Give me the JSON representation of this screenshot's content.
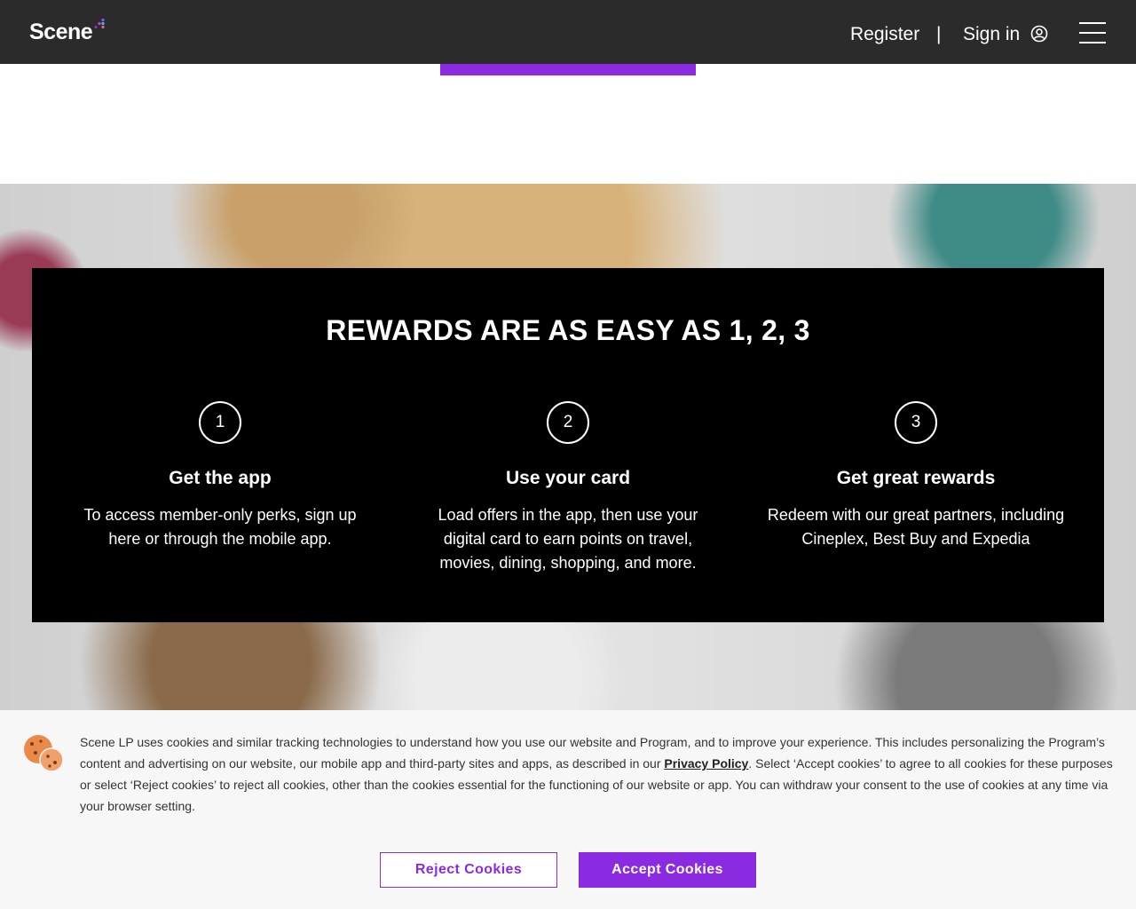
{
  "header": {
    "logo": "Scene",
    "register": "Register",
    "separator": "|",
    "signin": "Sign in"
  },
  "rewards": {
    "title": "REWARDS ARE AS EASY AS 1, 2, 3",
    "steps": [
      {
        "num": "1",
        "title": "Get the app",
        "text": "To access member-only perks, sign up here or through the mobile app."
      },
      {
        "num": "2",
        "title": "Use your card",
        "text": "Load offers in the app, then use your digital card to earn points on travel, movies, dining, shopping, and more."
      },
      {
        "num": "3",
        "title": "Get great rewards",
        "text": "Redeem with our great partners, including Cineplex, Best Buy and Expedia"
      }
    ]
  },
  "cookie": {
    "text_before": "Scene LP uses cookies and similar tracking technologies to understand how you use our website and Program, and to improve your experience. This includes personalizing the Program’s content and advertising on our website, our mobile app and third-party sites and apps, as described in our ",
    "link": "Privacy Policy",
    "text_after": ". Select ‘Accept cookies’ to agree to all cookies for these purposes or select ‘Reject cookies’ to reject all cookies, other than the cookies essential for the functioning of our website or app. You can withdraw your consent to the use of cookies at any time via your browser setting.",
    "reject": "Reject Cookies",
    "accept": "Accept Cookies"
  },
  "colors": {
    "accent": "#8a2be2",
    "header_bg": "#2b2b2b",
    "card_bg": "#000000"
  }
}
